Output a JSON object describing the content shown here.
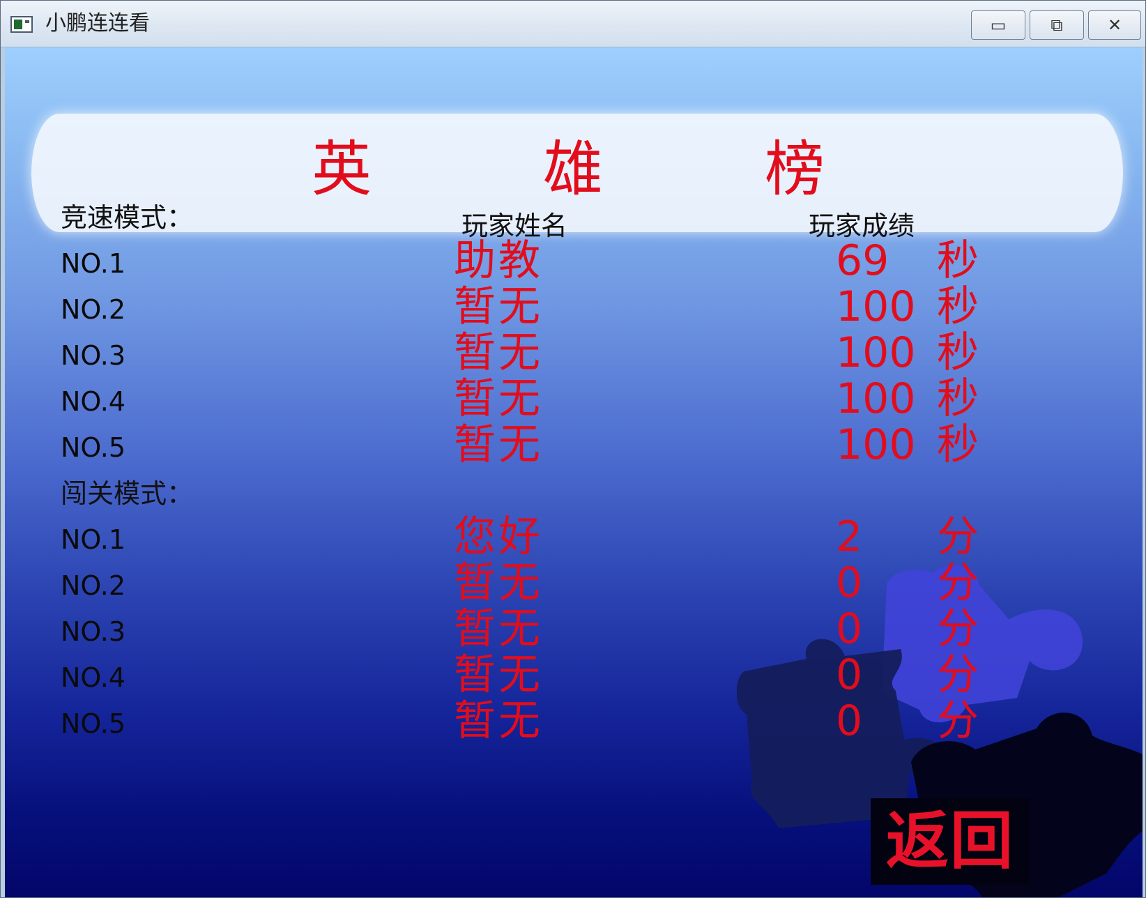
{
  "window": {
    "title": "小鹏连连看",
    "min_glyph": "▭",
    "max_glyph": "⧉",
    "close_glyph": "✕"
  },
  "heading": [
    "英",
    "雄",
    "榜"
  ],
  "columns": {
    "name": "玩家姓名",
    "score": "玩家成绩"
  },
  "speed_mode": {
    "label": "竞速模式：",
    "rows": [
      {
        "rank": "NO.1",
        "name": "助教",
        "score": "69",
        "unit": "秒"
      },
      {
        "rank": "NO.2",
        "name": "暂无",
        "score": "100",
        "unit": "秒"
      },
      {
        "rank": "NO.3",
        "name": "暂无",
        "score": "100",
        "unit": "秒"
      },
      {
        "rank": "NO.4",
        "name": "暂无",
        "score": "100",
        "unit": "秒"
      },
      {
        "rank": "NO.5",
        "name": "暂无",
        "score": "100",
        "unit": "秒"
      }
    ]
  },
  "level_mode": {
    "label": "闯关模式：",
    "rows": [
      {
        "rank": "NO.1",
        "name": "您好",
        "score": "2",
        "unit": "分"
      },
      {
        "rank": "NO.2",
        "name": "暂无",
        "score": "0",
        "unit": "分"
      },
      {
        "rank": "NO.3",
        "name": "暂无",
        "score": "0",
        "unit": "分"
      },
      {
        "rank": "NO.4",
        "name": "暂无",
        "score": "0",
        "unit": "分"
      },
      {
        "rank": "NO.5",
        "name": "暂无",
        "score": "0",
        "unit": "分"
      }
    ]
  },
  "return_label": "返回",
  "colors": {
    "highlight": "#e20d1c",
    "text": "#111111",
    "sky_top": "#9fcffe",
    "sky_bottom": "#03066a"
  }
}
